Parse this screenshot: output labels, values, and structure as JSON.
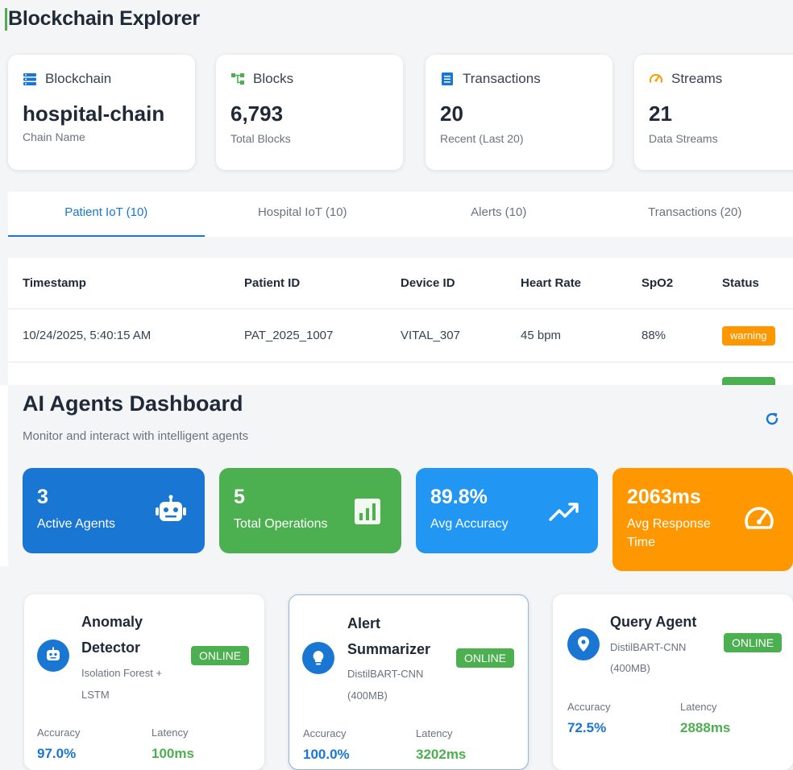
{
  "explorer": {
    "title": "Blockchain Explorer",
    "cards": [
      {
        "icon": "list-icon",
        "label": "Blockchain",
        "value": "hospital-chain",
        "sub": "Chain Name",
        "color": "#1976d2"
      },
      {
        "icon": "tree-icon",
        "label": "Blocks",
        "value": "6,793",
        "sub": "Total Blocks",
        "color": "#4caf50"
      },
      {
        "icon": "document-icon",
        "label": "Transactions",
        "value": "20",
        "sub": "Recent (Last 20)",
        "color": "#1976d2"
      },
      {
        "icon": "speedometer-icon",
        "label": "Streams",
        "value": "21",
        "sub": "Data Streams",
        "color": "#ff9800"
      }
    ],
    "tabs": [
      "Patient IoT (10)",
      "Hospital IoT (10)",
      "Alerts (10)",
      "Transactions (20)"
    ],
    "table": {
      "headers": [
        "Timestamp",
        "Patient ID",
        "Device ID",
        "Heart Rate",
        "SpO2",
        "Status"
      ],
      "rows": [
        {
          "timestamp": "10/24/2025, 5:40:15 AM",
          "patient_id": "PAT_2025_1007",
          "device_id": "VITAL_307",
          "heart_rate": "45 bpm",
          "spo2": "88%",
          "status": "warning"
        }
      ]
    }
  },
  "agents_dashboard": {
    "title": "AI Agents Dashboard",
    "subtitle": "Monitor and interact with intelligent agents",
    "stats": [
      {
        "value": "3",
        "label": "Active Agents",
        "icon": "robot-icon",
        "color": "#1976d2"
      },
      {
        "value": "5",
        "label": "Total Operations",
        "icon": "bar-chart-icon",
        "color": "#4caf50"
      },
      {
        "value": "89.8%",
        "label": "Avg Accuracy",
        "icon": "trending-up-icon",
        "color": "#2196f3"
      },
      {
        "value": "2063ms",
        "label": "Avg Response Time",
        "icon": "speedometer-icon",
        "color": "#ff9800"
      }
    ],
    "agents": [
      {
        "name_line1": "Anomaly",
        "name_line2": "Detector",
        "model_line1": "Isolation Forest +",
        "model_line2": "LSTM",
        "status": "ONLINE",
        "accuracy_label": "Accuracy",
        "accuracy": "97.0%",
        "latency_label": "Latency",
        "latency": "100ms",
        "icon": "robot-icon"
      },
      {
        "name_line1": "Alert",
        "name_line2": "Summarizer",
        "model_line1": "DistilBART-CNN",
        "model_line2": "(400MB)",
        "status": "ONLINE",
        "accuracy_label": "Accuracy",
        "accuracy": "100.0%",
        "latency_label": "Latency",
        "latency": "3202ms",
        "icon": "lightbulb-icon"
      },
      {
        "name_line1": "Query Agent",
        "model_line1": "DistilBART-CNN",
        "model_line2": "(400MB)",
        "status": "ONLINE",
        "accuracy_label": "Accuracy",
        "accuracy": "72.5%",
        "latency_label": "Latency",
        "latency": "2888ms",
        "icon": "location-pin-icon"
      }
    ]
  }
}
